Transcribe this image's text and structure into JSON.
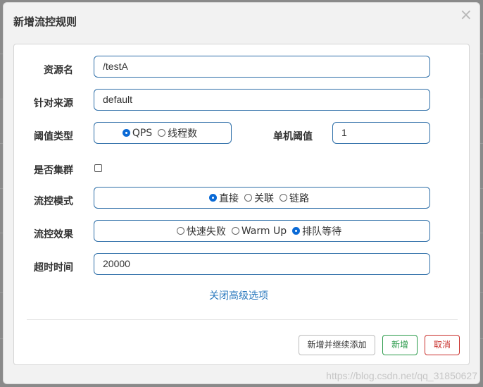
{
  "dialog": {
    "title": "新增流控规则",
    "close_glyph": "×"
  },
  "form": {
    "resource_label": "资源名",
    "resource_value": "/testA",
    "limit_app_label": "针对来源",
    "limit_app_value": "default",
    "grade_label": "阈值类型",
    "grade_options": [
      "QPS",
      "线程数"
    ],
    "grade_selected": "QPS",
    "count_label": "单机阈值",
    "count_value": "1",
    "cluster_label": "是否集群",
    "cluster_checked": false,
    "strategy_label": "流控模式",
    "strategy_options": [
      "直接",
      "关联",
      "链路"
    ],
    "strategy_selected": "直接",
    "behavior_label": "流控效果",
    "behavior_options": [
      "快速失败",
      "Warm Up",
      "排队等待"
    ],
    "behavior_selected": "排队等待",
    "timeout_label": "超时时间",
    "timeout_value": "20000",
    "advanced_toggle": "关闭高级选项"
  },
  "footer": {
    "add_continue_label": "新增并继续添加",
    "add_label": "新增",
    "cancel_label": "取消"
  },
  "watermark": "https://blog.csdn.net/qq_31850627",
  "colors": {
    "accent_blue": "#2d6ea8",
    "radio_blue": "#0a6ad6",
    "success_green": "#2a9a4a",
    "danger_red": "#c9302c",
    "link_blue": "#2e7bbf"
  }
}
